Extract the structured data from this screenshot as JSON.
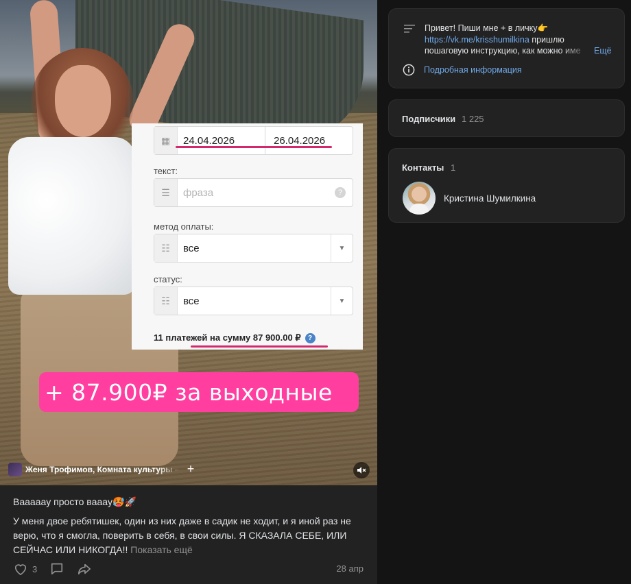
{
  "post": {
    "media": {
      "card": {
        "date_from": "24.04.2026",
        "date_to": "26.04.2026",
        "text_label": "текст:",
        "text_placeholder": "фраза",
        "payment_label": "метод оплаты:",
        "payment_value": "все",
        "status_label": "статус:",
        "status_value": "все",
        "summary": "11 платежей на сумму 87 900.00 ₽"
      },
      "banner_text": "+ 87.900₽ за выходные",
      "audio_label": "Женя Трофимов, Комната культуры – Л",
      "audio_add": "+"
    },
    "caption_title": "Ваааааy просто вaaay🥵🚀",
    "caption_body": "У меня двое ребятишек, один из них даже в садик не ходит, и я иной раз не верю, что я смогла, поверить в себя, в свои силы. Я СКАЗАЛА СЕБЕ, ИЛИ СЕЙЧАС ИЛИ НИКОГДА!!",
    "show_more": "Показать ещё",
    "likes": "3",
    "date": "28 апр"
  },
  "sidebar": {
    "info": {
      "line1": "Привет! Пиши мне + в личку👉",
      "link": "https://vk.me/krisshumilkina",
      "line2_tail": " пришлю",
      "line3": "пошаговую инструкцию, как можно име",
      "more": "Ещё",
      "details": "Подробная информация"
    },
    "subscribers": {
      "title": "Подписчики",
      "count": "1 225"
    },
    "contacts": {
      "title": "Контакты",
      "count": "1",
      "name": "Кристина Шумилкина"
    }
  },
  "colors": {
    "link": "#71aaeb",
    "banner": "#ff3ea0",
    "underline": "#d4286d",
    "card_bg": "#222222"
  }
}
